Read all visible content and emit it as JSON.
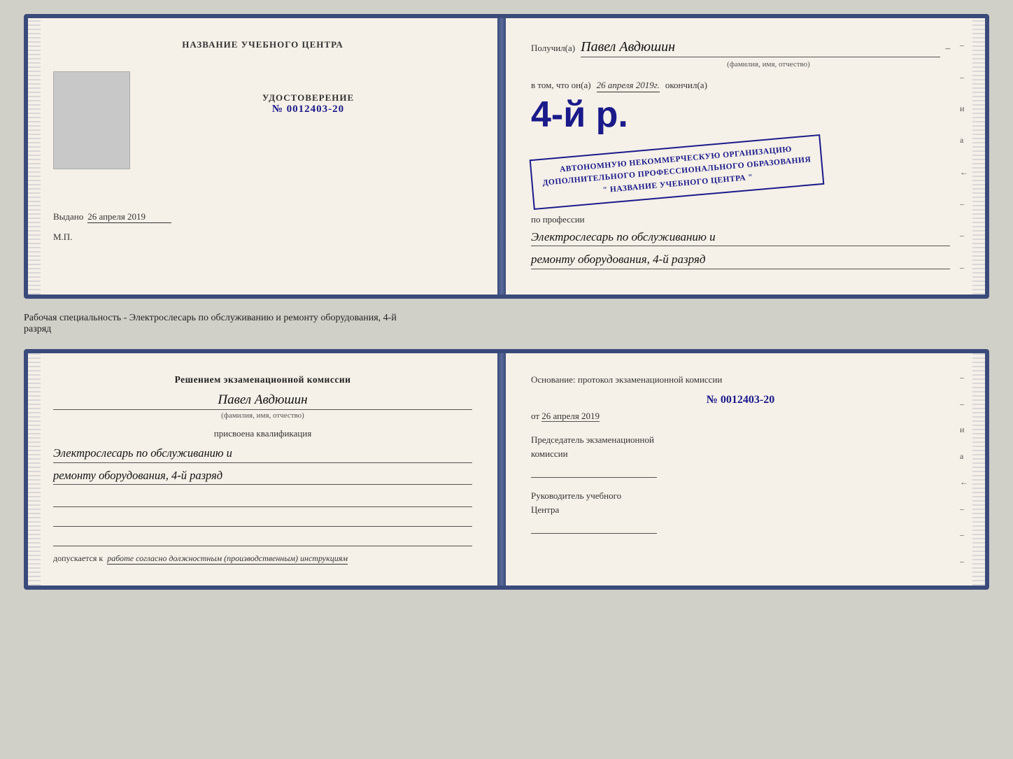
{
  "card1": {
    "left": {
      "center_title": "НАЗВАНИЕ УЧЕБНОГО ЦЕНТРА",
      "udostoverenie_label": "УДОСТОВЕРЕНИЕ",
      "number": "№ 0012403-20",
      "vydano_label": "Выдано",
      "vydano_date": "26 апреля 2019",
      "mp_label": "М.П."
    },
    "right": {
      "received_label": "Получил(а)",
      "received_name": "Павел Авдюшин",
      "fio_hint": "(фамилия, имя, отчество)",
      "v_tom_chto": "в том, что он(а)",
      "date": "26 апреля 2019г.",
      "okonchil": "окончил(а)",
      "razryad_big": "4-й р.",
      "org_line1": "АВТОНОМНУЮ НЕКОММЕРЧЕСКУЮ ОРГАНИЗАЦИЮ",
      "org_line2": "ДОПОЛНИТЕЛЬНОГО ПРОФЕССИОНАЛЬНОГО ОБРАЗОВАНИЯ",
      "org_line3": "\" НАЗВАНИЕ УЧЕБНОГО ЦЕНТРА \"",
      "po_professii": "по профессии",
      "profession_line1": "Электрослесарь по обслуживанию и",
      "profession_line2": "ремонту оборудования, 4-й разряд"
    }
  },
  "separator": {
    "text_line1": "Рабочая специальность - Электрослесарь по обслуживанию и ремонту оборудования, 4-й",
    "text_line2": "разряд"
  },
  "card2": {
    "left": {
      "decision_title": "Решением экзаменационной комиссии",
      "person_name": "Павел Авдюшин",
      "fio_hint": "(фамилия, имя, отчество)",
      "prisvoena": "присвоена квалификация",
      "qualification_line1": "Электрослесарь по обслуживанию и",
      "qualification_line2": "ремонту оборудования, 4-й разряд",
      "dopuskaetsya_label": "допускается к",
      "dopuskaetsya_value": "работе согласно должностным (производственным) инструкциям"
    },
    "right": {
      "osnov_title": "Основание: протокол экзаменационной комиссии",
      "protocol_num": "№ 0012403-20",
      "ot_label": "от",
      "ot_date": "26 апреля 2019",
      "predsedatel_line1": "Председатель экзаменационной",
      "predsedatel_line2": "комиссии",
      "rukovod_line1": "Руководитель учебного",
      "rukovod_line2": "Центра"
    }
  },
  "right_edge_chars": [
    "–",
    "–",
    "и",
    "а",
    "←",
    "–",
    "–",
    "–"
  ],
  "right_edge_chars2": [
    "–",
    "–",
    "и",
    "а",
    "←",
    "–",
    "–",
    "–"
  ]
}
